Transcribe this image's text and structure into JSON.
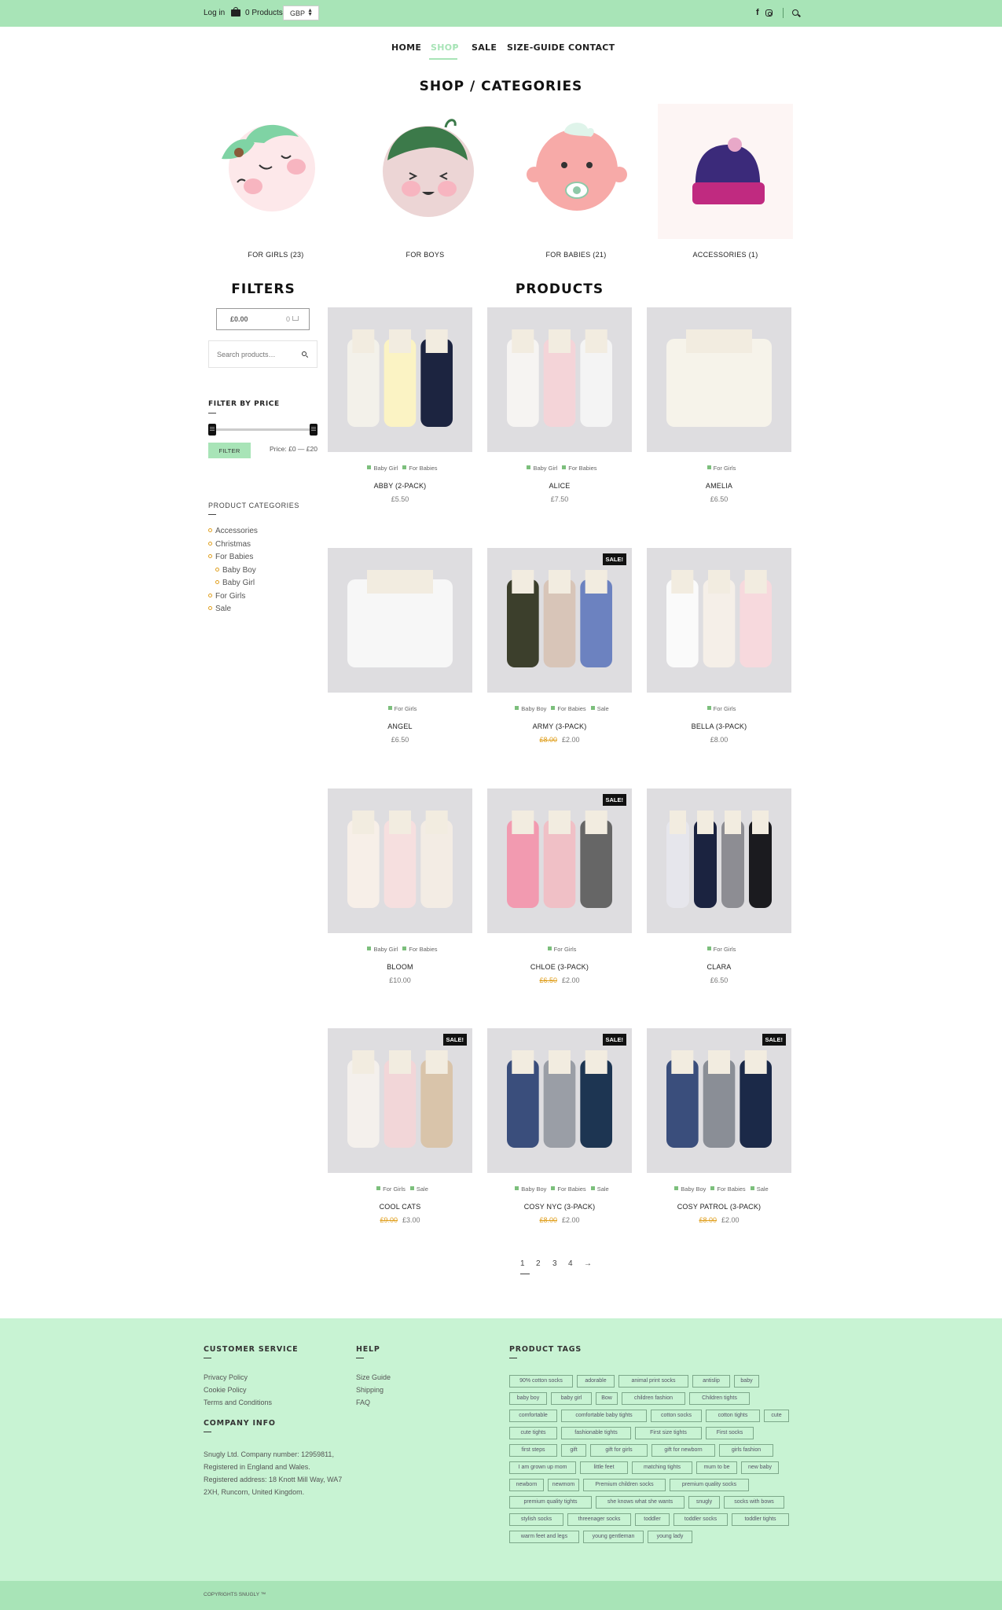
{
  "topbar": {
    "login": "Log in",
    "products_count": "0 Products",
    "currency": "GBP"
  },
  "nav": {
    "items": [
      "HOME",
      "SHOP",
      "SALE",
      "SIZE-GUIDE",
      "CONTACT"
    ],
    "active": "SHOP"
  },
  "page_title": "SHOP / CATEGORIES",
  "categories": [
    {
      "label": "FOR GIRLS (23)"
    },
    {
      "label": "FOR BOYS"
    },
    {
      "label": "FOR BABIES (21)"
    },
    {
      "label": "ACCESSORIES (1)"
    }
  ],
  "filters": {
    "heading": "FILTERS",
    "cart_total": "£0.00",
    "cart_count": "0",
    "search_placeholder": "Search products…",
    "price_heading": "FILTER BY PRICE",
    "filter_button": "FILTER",
    "price_range": "Price: £0 — £20",
    "categories_heading": "PRODUCT CATEGORIES",
    "categories": [
      "Accessories",
      "Christmas",
      "For Babies",
      "Baby Boy",
      "Baby Girl",
      "For Girls",
      "Sale"
    ]
  },
  "products_heading": "PRODUCTS",
  "products": [
    {
      "name": "ABBY (2-PACK)",
      "cats": [
        "Baby Girl",
        "For Babies"
      ],
      "price": "£5.50",
      "old_price": "",
      "sale": false
    },
    {
      "name": "ALICE",
      "cats": [
        "Baby Girl",
        "For Babies"
      ],
      "price": "£7.50",
      "old_price": "",
      "sale": false
    },
    {
      "name": "AMELIA",
      "cats": [
        "For Girls"
      ],
      "price": "£6.50",
      "old_price": "",
      "sale": false
    },
    {
      "name": "ANGEL",
      "cats": [
        "For Girls"
      ],
      "price": "£6.50",
      "old_price": "",
      "sale": false
    },
    {
      "name": "ARMY (3-PACK)",
      "cats": [
        "Baby Boy",
        "For Babies",
        "Sale"
      ],
      "price": "£2.00",
      "old_price": "£8.00",
      "sale": true
    },
    {
      "name": "BELLA (3-PACK)",
      "cats": [
        "For Girls"
      ],
      "price": "£8.00",
      "old_price": "",
      "sale": false
    },
    {
      "name": "BLOOM",
      "cats": [
        "Baby Girl",
        "For Babies"
      ],
      "price": "£10.00",
      "old_price": "",
      "sale": false
    },
    {
      "name": "CHLOE (3-PACK)",
      "cats": [
        "For Girls"
      ],
      "price": "£2.00",
      "old_price": "£6.50",
      "sale": true
    },
    {
      "name": "CLARA",
      "cats": [
        "For Girls"
      ],
      "price": "£6.50",
      "old_price": "",
      "sale": false
    },
    {
      "name": "COOL CATS",
      "cats": [
        "For Girls",
        "Sale"
      ],
      "price": "£3.00",
      "old_price": "£9.00",
      "sale": true
    },
    {
      "name": "COSY NYC (3-PACK)",
      "cats": [
        "Baby Boy",
        "For Babies",
        "Sale"
      ],
      "price": "£2.00",
      "old_price": "£8.00",
      "sale": true
    },
    {
      "name": "COSY PATROL (3-PACK)",
      "cats": [
        "Baby Boy",
        "For Babies",
        "Sale"
      ],
      "price": "£2.00",
      "old_price": "£8.00",
      "sale": true
    }
  ],
  "sale_badge": "SALE!",
  "pagination": [
    "1",
    "2",
    "3",
    "4",
    "→"
  ],
  "footer": {
    "customer_service": {
      "heading": "CUSTOMER SERVICE",
      "links": [
        "Privacy Policy",
        "Cookie Policy",
        "Terms and Conditions"
      ]
    },
    "help": {
      "heading": "HELP",
      "links": [
        "Size Guide",
        "Shipping",
        "FAQ"
      ]
    },
    "company": {
      "heading": "COMPANY INFO",
      "text": "Snugly Ltd. Company number: 12959811, Registered in England and Wales. Registered address: 18 Knott Mill Way, WA7 2XH, Runcorn, United Kingdom."
    },
    "tags_heading": "PRODUCT TAGS",
    "tags": [
      "90% cotton socks",
      "adorable",
      "animal print socks",
      "antislip",
      "baby",
      "baby boy",
      "baby girl",
      "Bow",
      "children fashion",
      "Children tights",
      "comfortable",
      "comfortable baby tights",
      "cotton socks",
      "cotton tights",
      "cute",
      "cute tights",
      "fashionable tights",
      "First size tights",
      "First socks",
      "first steps",
      "gift",
      "gift for girls",
      "gift for newborn",
      "girls fashion",
      "I am grown up mom",
      "little feet",
      "matching tights",
      "mum to be",
      "new baby",
      "newborn",
      "newmom",
      "Premium children socks",
      "premium quality socks",
      "premium quality tights",
      "she knows what she wants",
      "snugly",
      "socks with bows",
      "stylish socks",
      "threenager socks",
      "toddler",
      "toddler socks",
      "toddler tights",
      "warm feet and legs",
      "young gentleman",
      "young lady"
    ]
  },
  "copyright": "COPYRIGHTS SNUGLY ™"
}
